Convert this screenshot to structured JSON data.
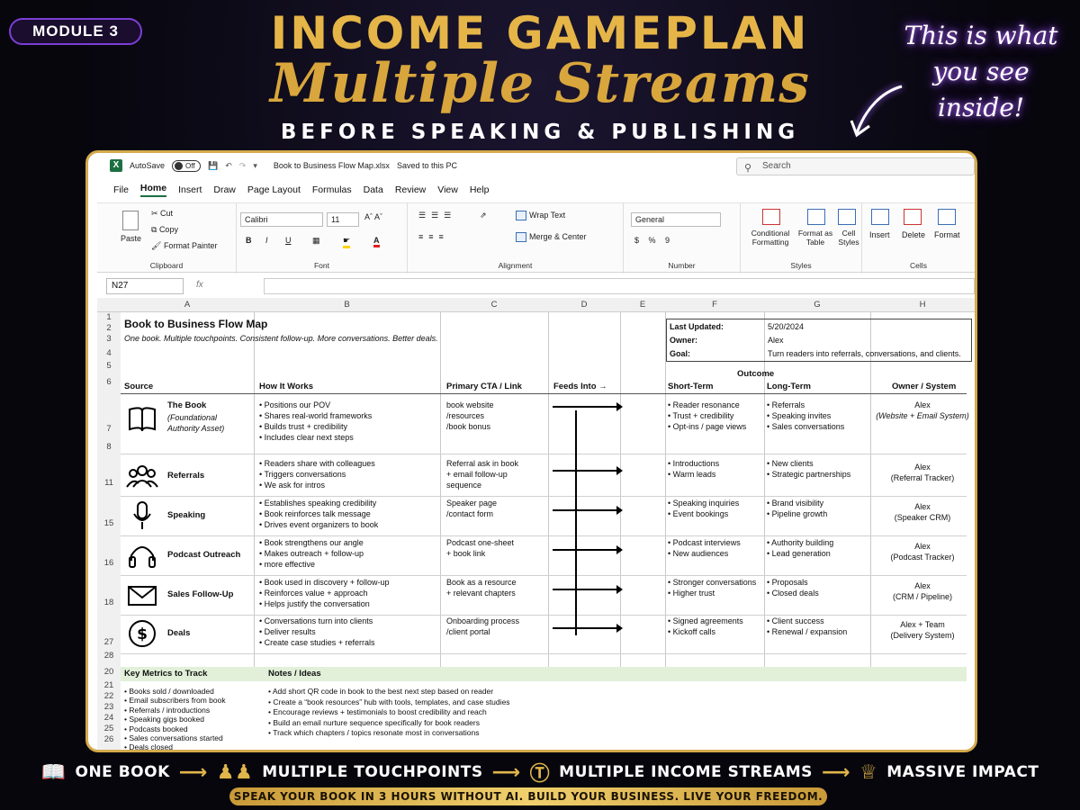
{
  "promo": {
    "module_badge": "MODULE 3",
    "title_line1": "INCOME GAMEPLAN",
    "title_line2": "Multiple Streams",
    "title_line3": "BEFORE SPEAKING & PUBLISHING",
    "neon_line1": "This is what",
    "neon_line2": "you see",
    "neon_line3": "inside!",
    "footer_items": [
      "ONE BOOK",
      "MULTIPLE TOUCHPOINTS",
      "MULTIPLE INCOME STREAMS",
      "MASSIVE IMPACT"
    ],
    "banner": "SPEAK YOUR BOOK IN 3 HOURS WITHOUT AI. BUILD YOUR BUSINESS. LIVE YOUR FREEDOM."
  },
  "excel": {
    "autosave_label": "AutoSave",
    "autosave_state": "Off",
    "filename": "Book to Business Flow Map.xlsx",
    "saved_status": "Saved to this PC",
    "search_placeholder": "Search",
    "menu": [
      "File",
      "Home",
      "Insert",
      "Draw",
      "Page Layout",
      "Formulas",
      "Data",
      "Review",
      "View",
      "Help"
    ],
    "ribbon": {
      "paste": "Paste",
      "cut": "Cut",
      "copy": "Copy",
      "format_painter": "Format Painter",
      "clipboard": "Clipboard",
      "font_name": "Calibri",
      "font_size": "11",
      "font_group": "Font",
      "bold": "B",
      "italic": "I",
      "underline": "U",
      "wrap_text": "Wrap Text",
      "merge_center": "Merge & Center",
      "alignment": "Alignment",
      "number_format": "General",
      "number_group": "Number",
      "conditional_formatting": "Conditional Formatting",
      "format_as_table": "Format as Table",
      "cell_styles": "Cell Styles",
      "styles": "Styles",
      "insert": "Insert",
      "delete": "Delete",
      "format": "Format",
      "cells": "Cells"
    },
    "name_box": "N27",
    "fx": "fx",
    "columns": [
      "A",
      "B",
      "C",
      "D",
      "E",
      "F",
      "G",
      "H"
    ],
    "sheet": {
      "title": "Book to Business Flow Map",
      "subtitle": "One book. Multiple touchpoints. Consistent follow-up. More conversations. Better deals.",
      "last_updated_label": "Last Updated:",
      "last_updated": "5/20/2024",
      "owner_label": "Owner:",
      "owner": "Alex",
      "goal_label": "Goal:",
      "goal": "Turn readers into referrals, conversations, and clients.",
      "outcome": "Outcome",
      "headers": [
        "Source",
        "How It Works",
        "Primary CTA / Link",
        "Feeds Into →",
        "Short-Term",
        "Long-Term",
        "Owner / System"
      ],
      "rows": [
        {
          "source": "The Book",
          "source_sub": "(Foundational Authority Asset)",
          "icon": "book-icon",
          "how": [
            "Positions our POV",
            "Shares real-world frameworks",
            "Builds trust + credibility",
            "Includes clear next steps"
          ],
          "cta": [
            "book website",
            "/resources",
            "/book bonus"
          ],
          "short": [
            "Reader resonance",
            "Trust + credibility",
            "Opt-ins / page views"
          ],
          "long": [
            "Referrals",
            "Speaking invites",
            "Sales conversations"
          ],
          "owner": [
            "Alex",
            "(Website + Email System)"
          ]
        },
        {
          "source": "Referrals",
          "icon": "people-icon",
          "how": [
            "Readers share with colleagues",
            "Triggers conversations",
            "We ask for intros"
          ],
          "cta": [
            "Referral ask in book",
            "+ email follow-up",
            "sequence"
          ],
          "short": [
            "Introductions",
            "Warm leads"
          ],
          "long": [
            "New clients",
            "Strategic partnerships"
          ],
          "owner": [
            "Alex",
            "(Referral Tracker)"
          ]
        },
        {
          "source": "Speaking",
          "icon": "microphone-icon",
          "how": [
            "Establishes speaking credibility",
            "Book reinforces talk message",
            "Drives event organizers to book"
          ],
          "cta": [
            "Speaker page",
            "/contact form"
          ],
          "short": [
            "Speaking inquiries",
            "Event bookings"
          ],
          "long": [
            "Brand visibility",
            "Pipeline growth"
          ],
          "owner": [
            "Alex",
            "(Speaker CRM)"
          ]
        },
        {
          "source": "Podcast Outreach",
          "icon": "headphones-icon",
          "how": [
            "Book strengthens our angle",
            "Makes outreach + follow-up",
            "more effective"
          ],
          "cta": [
            "Podcast one-sheet",
            "+ book link"
          ],
          "short": [
            "Podcast interviews",
            "New audiences"
          ],
          "long": [
            "Authority building",
            "Lead generation"
          ],
          "owner": [
            "Alex",
            "(Podcast Tracker)"
          ]
        },
        {
          "source": "Sales Follow-Up",
          "icon": "envelope-icon",
          "how": [
            "Book used in discovery + follow-up",
            "Reinforces value + approach",
            "Helps justify the conversation"
          ],
          "cta": [
            "Book as a resource",
            "+ relevant chapters"
          ],
          "short": [
            "Stronger conversations",
            "Higher trust"
          ],
          "long": [
            "Proposals",
            "Closed deals"
          ],
          "owner": [
            "Alex",
            "(CRM / Pipeline)"
          ]
        },
        {
          "source": "Deals",
          "icon": "dollar-icon",
          "how": [
            "Conversations turn into clients",
            "Deliver results",
            "Create case studies + referrals"
          ],
          "cta": [
            "Onboarding process",
            "/client portal"
          ],
          "short": [
            "Signed agreements",
            "Kickoff calls"
          ],
          "long": [
            "Client success",
            "Renewal / expansion"
          ],
          "owner": [
            "Alex + Team",
            "(Delivery System)"
          ]
        }
      ],
      "metrics_header": "Key Metrics to Track",
      "notes_header": "Notes / Ideas",
      "metrics": [
        "Books sold / downloaded",
        "Email subscribers from book",
        "Referrals / introductions",
        "Speaking gigs booked",
        "Podcasts booked",
        "Sales conversations started",
        "Deals closed"
      ],
      "notes": [
        "Add short QR code in book to the best next step based on reader",
        "Create a “book resources” hub with tools, templates, and case studies",
        "Encourage reviews + testimonials to boost credibility and reach",
        "Build an email nurture sequence specifically for book readers",
        "Track which chapters / topics resonate most in conversations"
      ],
      "row_numbers": [
        "1",
        "2",
        "3",
        "4",
        "5",
        "6",
        "7",
        "8",
        "11",
        "15",
        "16",
        "18",
        "27",
        "28",
        "20",
        "21",
        "22",
        "23",
        "24",
        "25",
        "26"
      ]
    }
  }
}
